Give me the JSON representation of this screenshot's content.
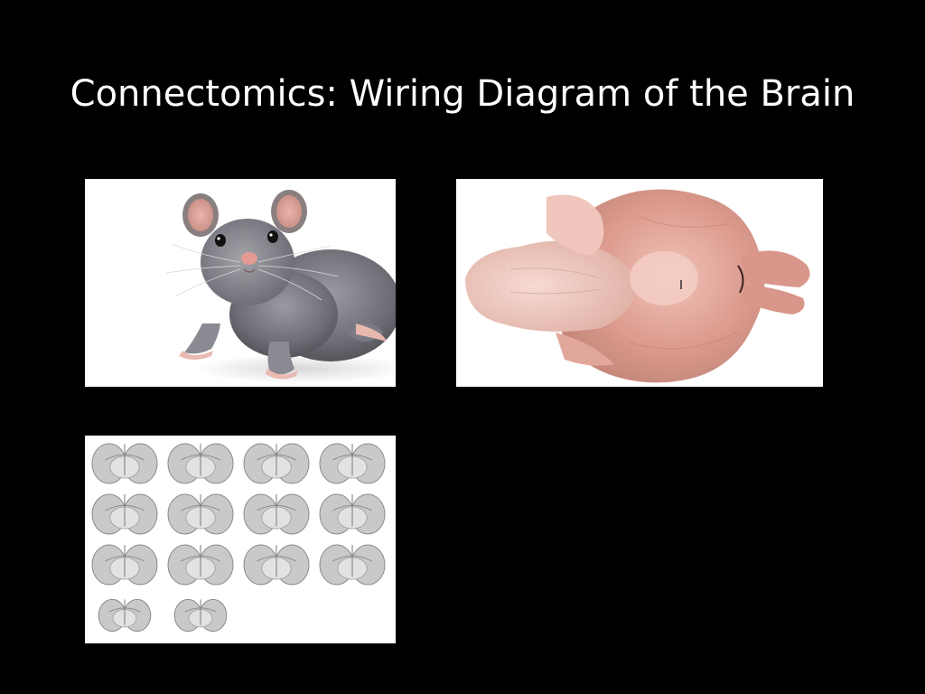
{
  "slide": {
    "title": "Connectomics: Wiring Diagram of the Brain",
    "background_color": "#000000",
    "title_color": "#ffffff"
  },
  "images": {
    "mouse_photo": {
      "icon": "mouse-photo"
    },
    "brain_photo": {
      "icon": "brain-photo"
    },
    "brain_sections": {
      "icon": "brain-sections-grid",
      "rows": [
        4,
        4,
        4,
        2
      ]
    }
  }
}
